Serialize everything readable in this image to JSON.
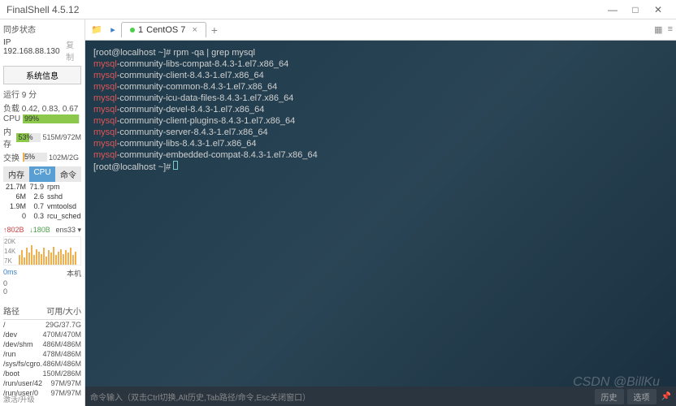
{
  "app": {
    "title": "FinalShell 4.5.12"
  },
  "win": {
    "min": "—",
    "max": "□",
    "close": "✕"
  },
  "sidebar": {
    "sync": "同步状态",
    "ip_label": "IP",
    "ip": "192.168.88.130",
    "copy": "复制",
    "sysinfo_btn": "系统信息",
    "running": "运行 9 分",
    "load_label": "负载",
    "load": "0.42, 0.83, 0.67",
    "cpu_label": "CPU",
    "cpu_pct": "99%",
    "mem_label": "内存",
    "mem_pct": "53%",
    "mem_val": "515M/972M",
    "swap_label": "交换",
    "swap_pct": "5%",
    "swap_val": "102M/2G",
    "tabs": [
      "内存",
      "CPU",
      "命令"
    ],
    "procs": [
      {
        "mem": "21.7M",
        "cpu": "71.9",
        "name": "rpm"
      },
      {
        "mem": "6M",
        "cpu": "2.6",
        "name": "sshd"
      },
      {
        "mem": "1.9M",
        "cpu": "0.7",
        "name": "vmtoolsd"
      },
      {
        "mem": "0",
        "cpu": "0.3",
        "name": "rcu_sched"
      }
    ],
    "net_up": "↑802B",
    "net_down": "↓180B",
    "net_if": "ens33 ▾",
    "chart_y": [
      "20K",
      "14K",
      "7K"
    ],
    "ping_ms": "0ms",
    "ping_host": "本机",
    "ping_r1": "0",
    "ping_r2": "0",
    "disk_hdr_path": "路径",
    "disk_hdr_size": "可用/大小",
    "disks": [
      {
        "path": "/",
        "size": "29G/37.7G"
      },
      {
        "path": "/dev",
        "size": "470M/470M"
      },
      {
        "path": "/dev/shm",
        "size": "486M/486M"
      },
      {
        "path": "/run",
        "size": "478M/486M"
      },
      {
        "path": "/sys/fs/cgro...",
        "size": "486M/486M"
      },
      {
        "path": "/boot",
        "size": "150M/286M"
      },
      {
        "path": "/run/user/42",
        "size": "97M/97M"
      },
      {
        "path": "/run/user/0",
        "size": "97M/97M"
      }
    ],
    "activate": "激活/升级"
  },
  "workspace": {
    "tab_num": "1",
    "tab_label": "CentOS 7",
    "tab_close": "×",
    "add": "+",
    "terminal_lines": [
      {
        "prompt": "[root@localhost ~]# ",
        "cmd": "rpm -qa | grep mysql"
      },
      {
        "pkg": "mysql",
        "rest": "-community-libs-compat-8.4.3-1.el7.x86_64"
      },
      {
        "pkg": "mysql",
        "rest": "-community-client-8.4.3-1.el7.x86_64"
      },
      {
        "pkg": "mysql",
        "rest": "-community-common-8.4.3-1.el7.x86_64"
      },
      {
        "pkg": "mysql",
        "rest": "-community-icu-data-files-8.4.3-1.el7.x86_64"
      },
      {
        "pkg": "mysql",
        "rest": "-community-devel-8.4.3-1.el7.x86_64"
      },
      {
        "pkg": "mysql",
        "rest": "-community-client-plugins-8.4.3-1.el7.x86_64"
      },
      {
        "pkg": "mysql",
        "rest": "-community-server-8.4.3-1.el7.x86_64"
      },
      {
        "pkg": "mysql",
        "rest": "-community-libs-8.4.3-1.el7.x86_64"
      },
      {
        "pkg": "mysql",
        "rest": "-community-embedded-compat-8.4.3-1.el7.x86_64"
      },
      {
        "prompt": "[root@localhost ~]# ",
        "cmd": ""
      }
    ],
    "cmd_hint": "命令输入（双击Ctrl切换,Alt历史,Tab路径/命令,Esc关闭窗口）",
    "btn_history": "历史",
    "btn_option": "选项",
    "pin": "📌"
  },
  "watermark": "CSDN @BillKu"
}
